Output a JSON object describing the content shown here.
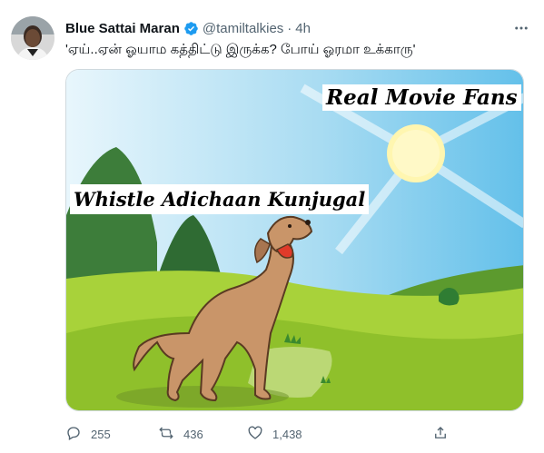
{
  "author": {
    "name": "Blue Sattai Maran",
    "handle": "@tamiltalkies",
    "separator": "·",
    "time": "4h",
    "verified": true
  },
  "tweet": {
    "text": "'ஏய்..ஏன் ஓயாம கத்திட்டு இருக்க? போய் ஓரமா உக்காரு'"
  },
  "media": {
    "caption_top": "Real Movie Fans",
    "caption_left": "Whistle Adichaan Kunjugal"
  },
  "actions": {
    "reply_count": "255",
    "retweet_count": "436",
    "like_count": "1,438"
  },
  "icons": {
    "verified": "verified-badge-icon",
    "more": "more-icon",
    "reply": "reply-icon",
    "retweet": "retweet-icon",
    "like": "heart-icon",
    "share": "share-icon"
  },
  "colors": {
    "verified": "#1d9bf0",
    "secondary_text": "#536471",
    "sky": "#8fd0ef",
    "grass": "#a8d23a",
    "dog": "#c99569"
  }
}
